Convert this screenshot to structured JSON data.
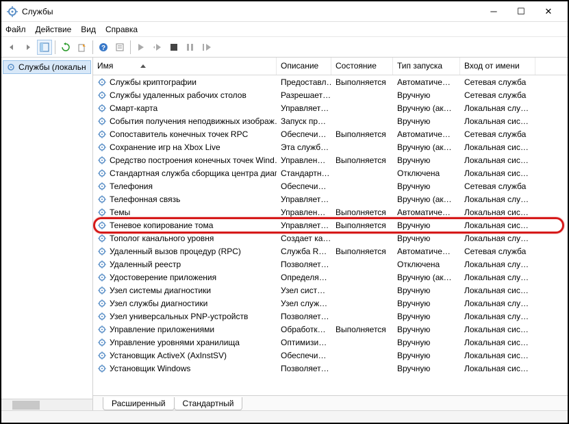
{
  "window": {
    "title": "Службы"
  },
  "menu": {
    "file": "Файл",
    "action": "Действие",
    "view": "Вид",
    "help": "Справка"
  },
  "sidebar": {
    "root": "Службы (локальн"
  },
  "columns": {
    "name": "Имя",
    "desc": "Описание",
    "state": "Состояние",
    "startup": "Тип запуска",
    "logon": "Вход от имени"
  },
  "tabs": {
    "extended": "Расширенный",
    "standard": "Стандартный"
  },
  "services": [
    {
      "name": "Службы криптографии",
      "desc": "Предоставл…",
      "state": "Выполняется",
      "startup": "Автоматиче…",
      "logon": "Сетевая служба"
    },
    {
      "name": "Службы удаленных рабочих столов",
      "desc": "Разрешает…",
      "state": "",
      "startup": "Вручную",
      "logon": "Сетевая служба"
    },
    {
      "name": "Смарт-карта",
      "desc": "Управляет…",
      "state": "",
      "startup": "Вручную (ак…",
      "logon": "Локальная слу…"
    },
    {
      "name": "События получения неподвижных изображ…",
      "desc": "Запуск пр…",
      "state": "",
      "startup": "Вручную",
      "logon": "Локальная сис…"
    },
    {
      "name": "Сопоставитель конечных точек RPC",
      "desc": "Обеспечи…",
      "state": "Выполняется",
      "startup": "Автоматиче…",
      "logon": "Сетевая служба"
    },
    {
      "name": "Сохранение игр на Xbox Live",
      "desc": "Эта служб…",
      "state": "",
      "startup": "Вручную (ак…",
      "logon": "Локальная сис…"
    },
    {
      "name": "Средство построения конечных точек Wind…",
      "desc": "Управлен…",
      "state": "Выполняется",
      "startup": "Вручную",
      "logon": "Локальная сис…"
    },
    {
      "name": "Стандартная служба сборщика центра диаг…",
      "desc": "Стандартн…",
      "state": "",
      "startup": "Отключена",
      "logon": "Локальная сис…"
    },
    {
      "name": "Телефония",
      "desc": "Обеспечи…",
      "state": "",
      "startup": "Вручную",
      "logon": "Сетевая служба"
    },
    {
      "name": "Телефонная связь",
      "desc": "Управляет…",
      "state": "",
      "startup": "Вручную (ак…",
      "logon": "Локальная слу…"
    },
    {
      "name": "Темы",
      "desc": "Управлен…",
      "state": "Выполняется",
      "startup": "Автоматиче…",
      "logon": "Локальная сис…"
    },
    {
      "name": "Теневое копирование тома",
      "desc": "Управляет…",
      "state": "Выполняется",
      "startup": "Вручную",
      "logon": "Локальная сис…",
      "hl": true
    },
    {
      "name": "Тополог канального уровня",
      "desc": "Создает ка…",
      "state": "",
      "startup": "Вручную",
      "logon": "Локальная слу…"
    },
    {
      "name": "Удаленный вызов процедур (RPC)",
      "desc": "Служба R…",
      "state": "Выполняется",
      "startup": "Автоматиче…",
      "logon": "Сетевая служба"
    },
    {
      "name": "Удаленный реестр",
      "desc": "Позволяет…",
      "state": "",
      "startup": "Отключена",
      "logon": "Локальная слу…"
    },
    {
      "name": "Удостоверение приложения",
      "desc": "Определя…",
      "state": "",
      "startup": "Вручную (ак…",
      "logon": "Локальная слу…"
    },
    {
      "name": "Узел системы диагностики",
      "desc": "Узел сист…",
      "state": "",
      "startup": "Вручную",
      "logon": "Локальная сис…"
    },
    {
      "name": "Узел службы диагностики",
      "desc": "Узел служ…",
      "state": "",
      "startup": "Вручную",
      "logon": "Локальная слу…"
    },
    {
      "name": "Узел универсальных PNP-устройств",
      "desc": "Позволяет…",
      "state": "",
      "startup": "Вручную",
      "logon": "Локальная слу…"
    },
    {
      "name": "Управление приложениями",
      "desc": "Обработк…",
      "state": "Выполняется",
      "startup": "Вручную",
      "logon": "Локальная сис…"
    },
    {
      "name": "Управление уровнями хранилища",
      "desc": "Оптимизи…",
      "state": "",
      "startup": "Вручную",
      "logon": "Локальная сис…"
    },
    {
      "name": "Установщик ActiveX (AxInstSV)",
      "desc": "Обеспечи…",
      "state": "",
      "startup": "Вручную",
      "logon": "Локальная сис…"
    },
    {
      "name": "Установщик Windows",
      "desc": "Позволяет…",
      "state": "",
      "startup": "Вручную",
      "logon": "Локальная сис…"
    }
  ]
}
